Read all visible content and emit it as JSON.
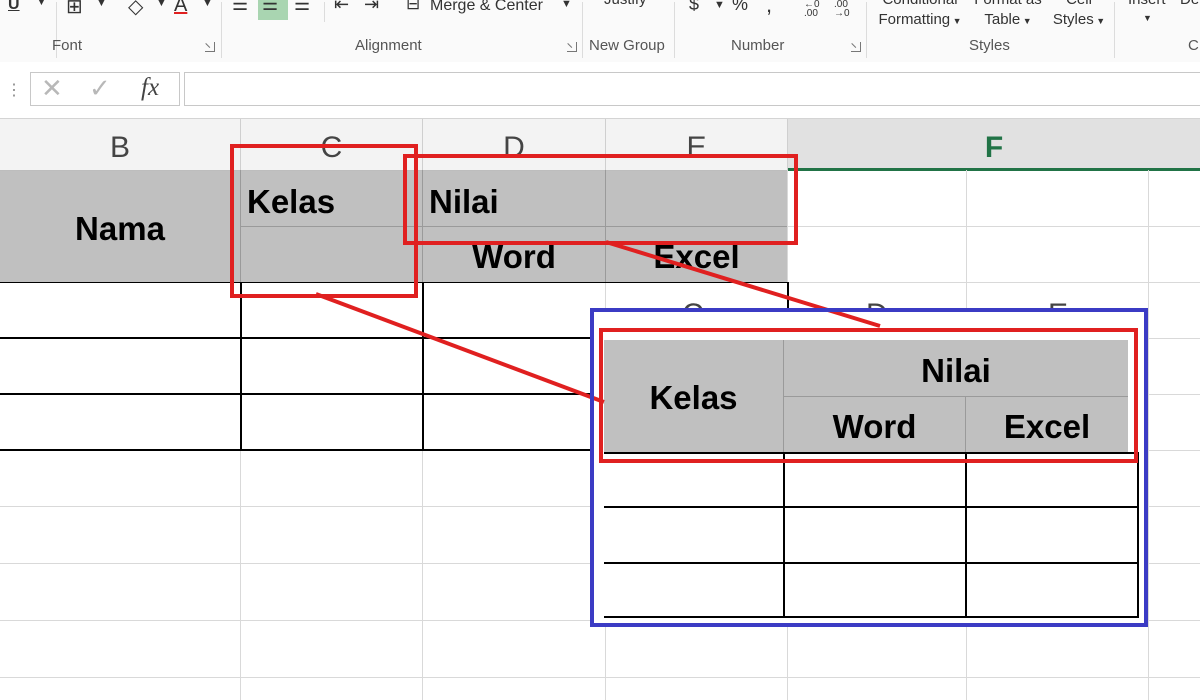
{
  "ribbon": {
    "merge_center": "Merge & Center",
    "justify": "Justify",
    "number_format": [
      "$",
      "%",
      ","
    ],
    "conditional": [
      "Conditional",
      "Formatting"
    ],
    "format_as": [
      "Format as",
      "Table"
    ],
    "cell_styles": [
      "Cell",
      "Styles"
    ],
    "insert": "Insert",
    "delete_partial": "De",
    "groups": {
      "font": "Font",
      "alignment": "Alignment",
      "new_group": "New Group",
      "number": "Number",
      "styles": "Styles",
      "cells_partial": "C"
    }
  },
  "formula_bar": {
    "cancel": "✕",
    "enter": "✓",
    "fx": "fx",
    "value": ""
  },
  "columns": [
    "B",
    "C",
    "D",
    "E",
    "F"
  ],
  "sheet": {
    "nama": "Nama",
    "kelas": "Kelas",
    "nilai": "Nilai",
    "word": "Word",
    "excel": "Excel"
  },
  "inset": {
    "col_fragments": [
      "C",
      "D",
      "E"
    ],
    "kelas": "Kelas",
    "nilai": "Nilai",
    "word": "Word",
    "excel": "Excel"
  },
  "colors": {
    "header_fill": "#c0c0c0",
    "annotation_red": "#e02020",
    "annotation_blue": "#3b3bc4",
    "excel_green": "#217346"
  }
}
